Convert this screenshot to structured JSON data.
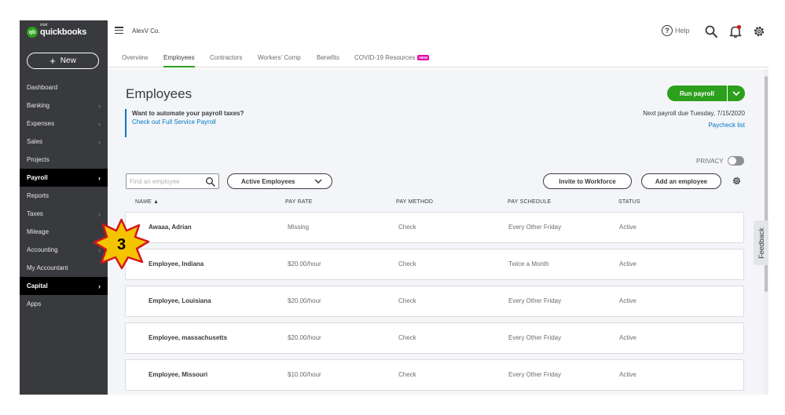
{
  "app": {
    "logo_intuit": "intuit",
    "logo_text": "quickbooks",
    "logo_mark": "qb",
    "company_name": "AlexV Co.",
    "help_label": "Help"
  },
  "sidebar": {
    "new_label": "New",
    "items": [
      {
        "label": "Dashboard",
        "chevron": ""
      },
      {
        "label": "Banking",
        "chevron": "›"
      },
      {
        "label": "Expenses",
        "chevron": "›"
      },
      {
        "label": "Sales",
        "chevron": "›"
      },
      {
        "label": "Projects",
        "chevron": ""
      },
      {
        "label": "Payroll",
        "chevron": "›"
      },
      {
        "label": "Reports",
        "chevron": ""
      },
      {
        "label": "Taxes",
        "chevron": "›"
      },
      {
        "label": "Mileage",
        "chevron": ""
      },
      {
        "label": "Accounting",
        "chevron": "›"
      },
      {
        "label": "My Accountant",
        "chevron": ""
      },
      {
        "label": "Capital",
        "chevron": "›"
      },
      {
        "label": "Apps",
        "chevron": ""
      }
    ]
  },
  "tabs": [
    {
      "label": "Overview"
    },
    {
      "label": "Employees"
    },
    {
      "label": "Contractors"
    },
    {
      "label": "Workers' Comp"
    },
    {
      "label": "Benefits"
    },
    {
      "label": "COVID-19 Resources",
      "badge": "NEW"
    }
  ],
  "page": {
    "title": "Employees",
    "promo_title": "Want to automate your payroll taxes?",
    "promo_link": "Check out Full Service Payroll",
    "run_payroll_label": "Run payroll",
    "next_payroll": "Next payroll due Tuesday, 7/15/2020",
    "paycheck_list": "Paycheck list",
    "privacy_label": "PRIVACY",
    "search_placeholder": "Find an employee",
    "filter_value": "Active Employees",
    "invite_label": "Invite to Workforce",
    "add_employee_label": "Add an employee",
    "feedback_label": "Feedback"
  },
  "table": {
    "columns": [
      "NAME ▲",
      "PAY RATE",
      "PAY METHOD",
      "PAY SCHEDULE",
      "STATUS"
    ],
    "rows": [
      {
        "name": "Awaaa, Adrian",
        "rate": "Missing",
        "method": "Check",
        "schedule": "Every Other Friday",
        "status": "Active"
      },
      {
        "name": "Employee, Indiana",
        "rate": "$20.00/hour",
        "method": "Check",
        "schedule": "Twice a Month",
        "status": "Active"
      },
      {
        "name": "Employee, Louisiana",
        "rate": "$20.00/hour",
        "method": "Check",
        "schedule": "Every Other Friday",
        "status": "Active"
      },
      {
        "name": "Employee, massachusetts",
        "rate": "$20.00/hour",
        "method": "Check",
        "schedule": "Every Other Friday",
        "status": "Active"
      },
      {
        "name": "Employee, Missouri",
        "rate": "$10.00/hour",
        "method": "Check",
        "schedule": "Every Other Friday",
        "status": "Active"
      }
    ]
  },
  "callout": {
    "number": "3"
  },
  "colors": {
    "sidebar_bg": "#393a3d",
    "active_nav_bg": "#000000",
    "brand_green": "#2ca01c",
    "link_blue": "#0077c5",
    "badge_pink": "#e20da8",
    "callout_fill": "#f5c400",
    "callout_stroke": "#d4161d"
  }
}
